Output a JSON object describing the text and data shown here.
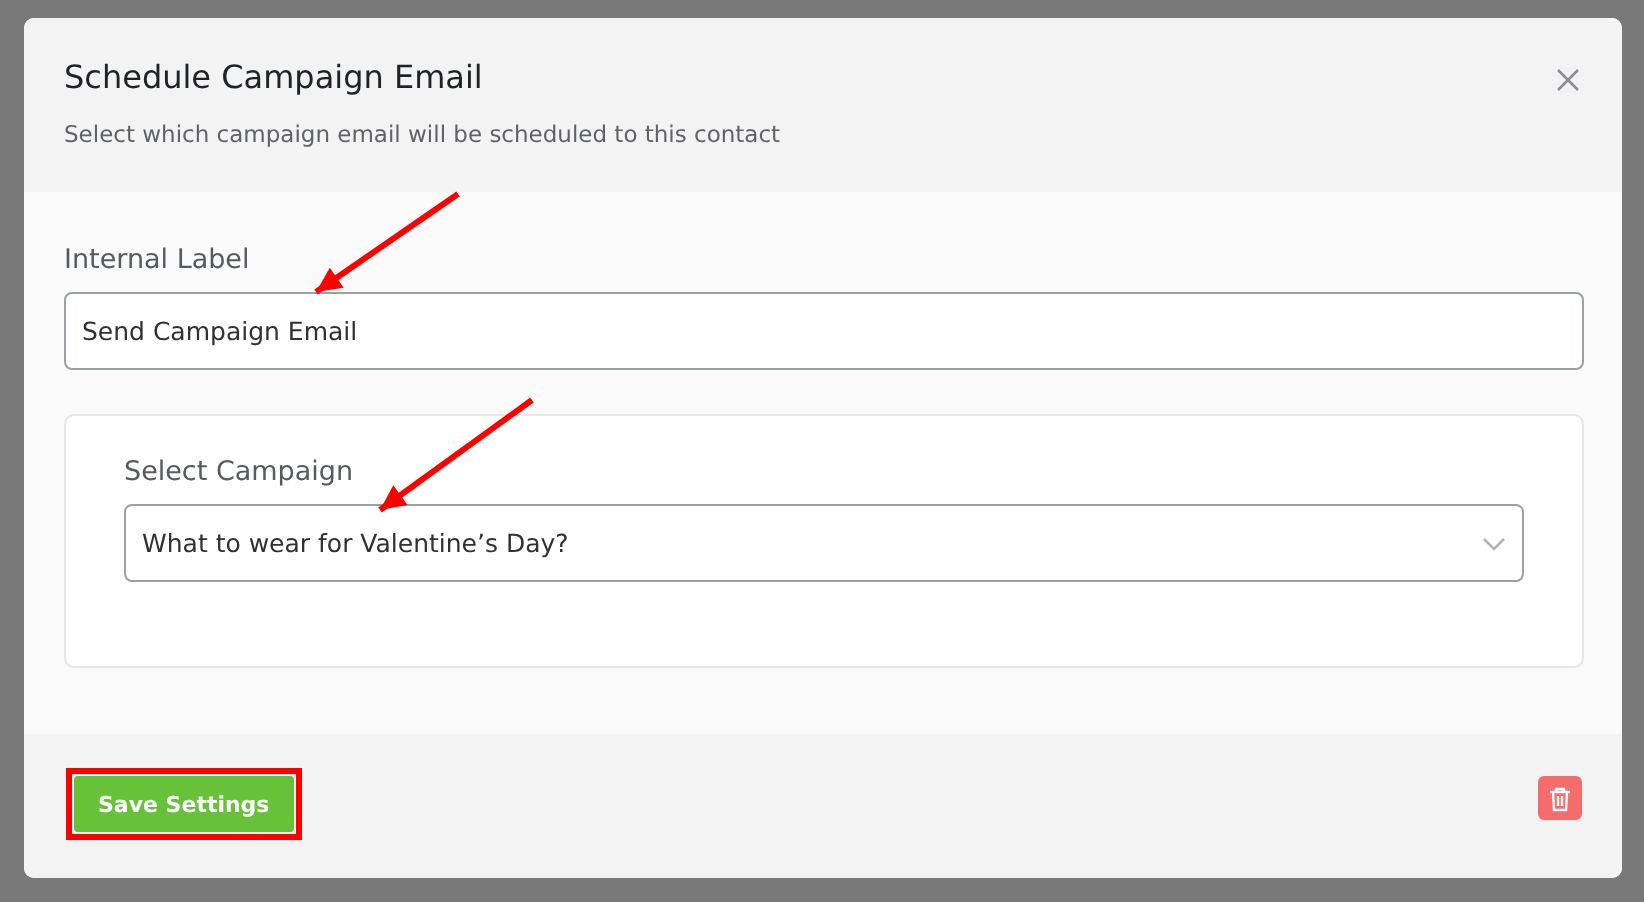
{
  "dialog": {
    "title": "Schedule Campaign Email",
    "subtitle": "Select which campaign email will be scheduled to this contact"
  },
  "internal_label": {
    "label": "Internal Label",
    "value": "Send Campaign Email"
  },
  "campaign": {
    "label": "Select Campaign",
    "value": "What to wear for Valentine’s Day?"
  },
  "footer": {
    "save": "Save Settings",
    "save_highlighted": true
  }
}
